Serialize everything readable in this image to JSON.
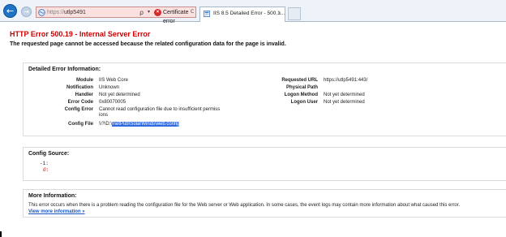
{
  "browser": {
    "address_url_highlight": "https://",
    "address_url_host": "utlp5491",
    "search_glyph": "ρ",
    "dropdown_glyph": "▾",
    "cert_error_label": "Certificate error",
    "refresh_glyph": "C",
    "tab_label": "IIS 8.5 Detailed Error - 500.1...",
    "tab_close": "×",
    "back_glyph": "←",
    "forward_glyph": "→",
    "colors": {
      "address_error_bg": "#fbe0e0",
      "chrome_bg": "#eef3f9",
      "back_button": "#1e73c7"
    },
    "icons": [
      "back-arrow-icon",
      "forward-arrow-icon",
      "site-favicon-icon",
      "search-icon",
      "certificate-error-icon",
      "refresh-icon",
      "tab-favicon-icon",
      "tab-close-icon"
    ]
  },
  "error": {
    "title": "HTTP Error 500.19 - Internal Server Error",
    "subtitle": "The requested page cannot be accessed because the related configuration data for the page is invalid.",
    "title_color": "#cc0000"
  },
  "detail": {
    "heading": "Detailed Error Information:",
    "left": [
      {
        "label": "Module",
        "value": "IIS Web Core"
      },
      {
        "label": "Notification",
        "value": "Unknown"
      },
      {
        "label": "Handler",
        "value": "Not yet determined"
      },
      {
        "label": "Error Code",
        "value": "0x80070005"
      },
      {
        "label": "Config Error",
        "value": "Cannot read configuration file due to insufficient permiss",
        "value2": "ions"
      },
      {
        "label": "Config File",
        "value_prefix": "\\\\?\\D:\\",
        "value_highlight": "InetPub\\SolarWinds\\web.config"
      }
    ],
    "right": [
      {
        "label": "Requested URL",
        "value": "https://utlp5491:443/"
      },
      {
        "label": "Physical Path",
        "value": ""
      },
      {
        "label": "Logon Method",
        "value": "Not yet determined"
      },
      {
        "label": "Logon User",
        "value": "Not yet determined"
      }
    ]
  },
  "config_source": {
    "heading": "Config Source:",
    "line_number": "-1:",
    "line_code": "0:"
  },
  "more_info": {
    "heading": "More Information:",
    "text": "This error occurs when there is a problem reading the configuration file for the Web server or Web application. In some cases, the event logs may contain more information about what caused this error.",
    "link_label": "View more information »",
    "link_color": "#1a55c0"
  }
}
